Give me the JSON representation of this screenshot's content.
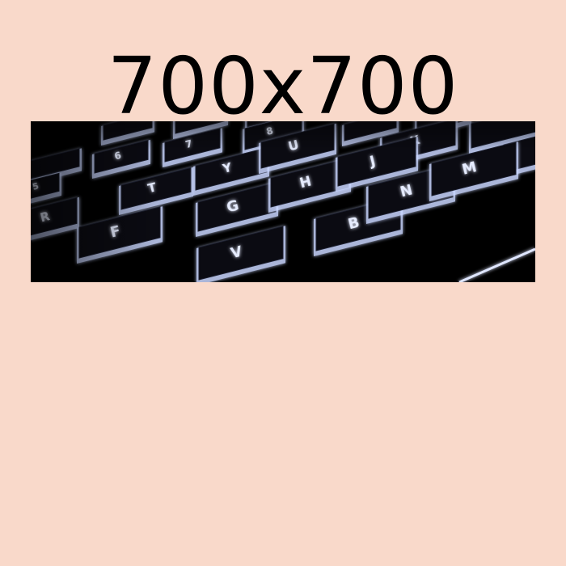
{
  "page": {
    "background_color": "#f9d9ca",
    "dimensions_label": "700x700"
  },
  "banner": {
    "image_subject": "backlit-keyboard-photo",
    "background_color": "#000000",
    "glow_color": "#c9d6ff",
    "key_color": "#0b0b12",
    "key_legend_color": "#e6ecff",
    "visible_key_legends": [
      {
        "name": "key-r",
        "label": "R"
      },
      {
        "name": "key-t",
        "label": "T"
      },
      {
        "name": "key-y",
        "label": "Y"
      },
      {
        "name": "key-u",
        "label": "U"
      },
      {
        "name": "key-j",
        "label": "J"
      },
      {
        "name": "key-k",
        "label": "K"
      },
      {
        "name": "key-h",
        "label": "H"
      },
      {
        "name": "key-g",
        "label": "G"
      },
      {
        "name": "key-f",
        "label": "F"
      },
      {
        "name": "key-n",
        "label": "N"
      },
      {
        "name": "key-m",
        "label": "M"
      },
      {
        "name": "key-b",
        "label": "B"
      },
      {
        "name": "key-v",
        "label": "V"
      },
      {
        "name": "key-5",
        "label": "5"
      },
      {
        "name": "key-6",
        "label": "6"
      },
      {
        "name": "key-7",
        "label": "7"
      },
      {
        "name": "key-8",
        "label": "8"
      }
    ]
  }
}
